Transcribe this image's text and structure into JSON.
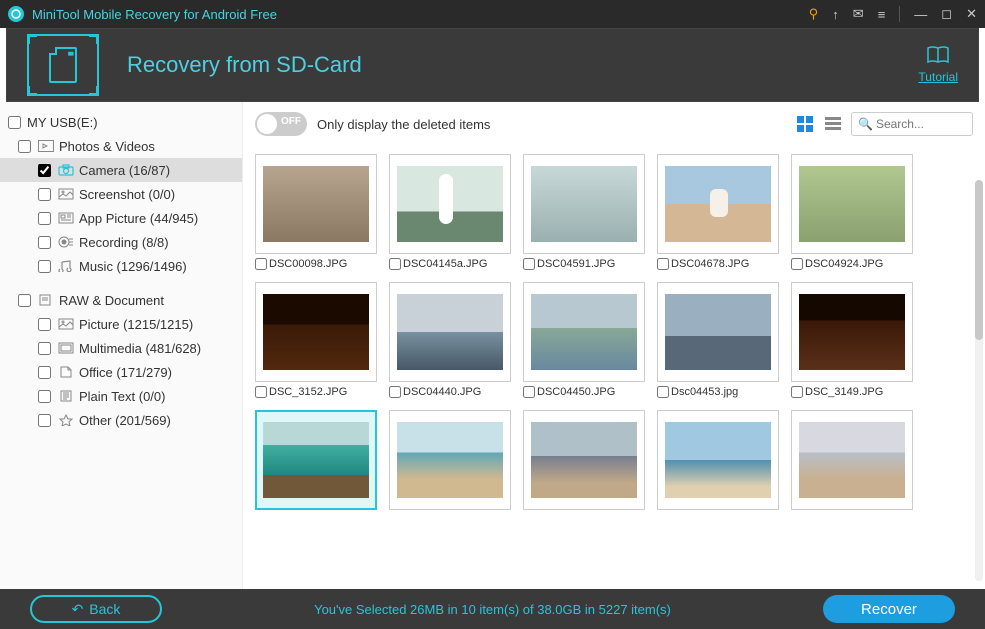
{
  "titlebar": {
    "title": "MiniTool Mobile Recovery for Android Free"
  },
  "header": {
    "title": "Recovery from SD-Card",
    "tutorial": "Tutorial"
  },
  "sidebar": {
    "root": "MY USB(E:)",
    "group1": "Photos & Videos",
    "items1": [
      {
        "label": "Camera (16/87)",
        "checked": true
      },
      {
        "label": "Screenshot (0/0)",
        "checked": false
      },
      {
        "label": "App Picture (44/945)",
        "checked": false
      },
      {
        "label": "Recording (8/8)",
        "checked": false
      },
      {
        "label": "Music (1296/1496)",
        "checked": false
      }
    ],
    "group2": "RAW & Document",
    "items2": [
      {
        "label": "Picture (1215/1215)"
      },
      {
        "label": "Multimedia (481/628)"
      },
      {
        "label": "Office (171/279)"
      },
      {
        "label": "Plain Text (0/0)"
      },
      {
        "label": "Other (201/569)"
      }
    ]
  },
  "toolbar": {
    "toggle_state": "OFF",
    "toggle_label": "Only display the deleted items",
    "search_placeholder": "Search..."
  },
  "grid": [
    {
      "name": "DSC00098.JPG",
      "cls": "img-cat"
    },
    {
      "name": "DSC04145a.JPG",
      "cls": "img-bird"
    },
    {
      "name": "DSC04591.JPG",
      "cls": "img-dragonfly"
    },
    {
      "name": "DSC04678.JPG",
      "cls": "img-dog"
    },
    {
      "name": "DSC04924.JPG",
      "cls": "img-butterfly"
    },
    {
      "name": "DSC_3152.JPG",
      "cls": "img-night1"
    },
    {
      "name": "DSC04440.JPG",
      "cls": "img-mtn1"
    },
    {
      "name": "DSC04450.JPG",
      "cls": "img-lake"
    },
    {
      "name": "Dsc04453.jpg",
      "cls": "img-mtn2"
    },
    {
      "name": "DSC_3149.JPG",
      "cls": "img-night2"
    },
    {
      "name": "",
      "cls": "img-beach1",
      "selected": true
    },
    {
      "name": "",
      "cls": "img-beach2"
    },
    {
      "name": "",
      "cls": "img-boats"
    },
    {
      "name": "",
      "cls": "img-beach3"
    },
    {
      "name": "",
      "cls": "img-beach4"
    }
  ],
  "footer": {
    "back": "Back",
    "status": "You've Selected 26MB in 10 item(s) of 38.0GB in 5227 item(s)",
    "recover": "Recover"
  }
}
